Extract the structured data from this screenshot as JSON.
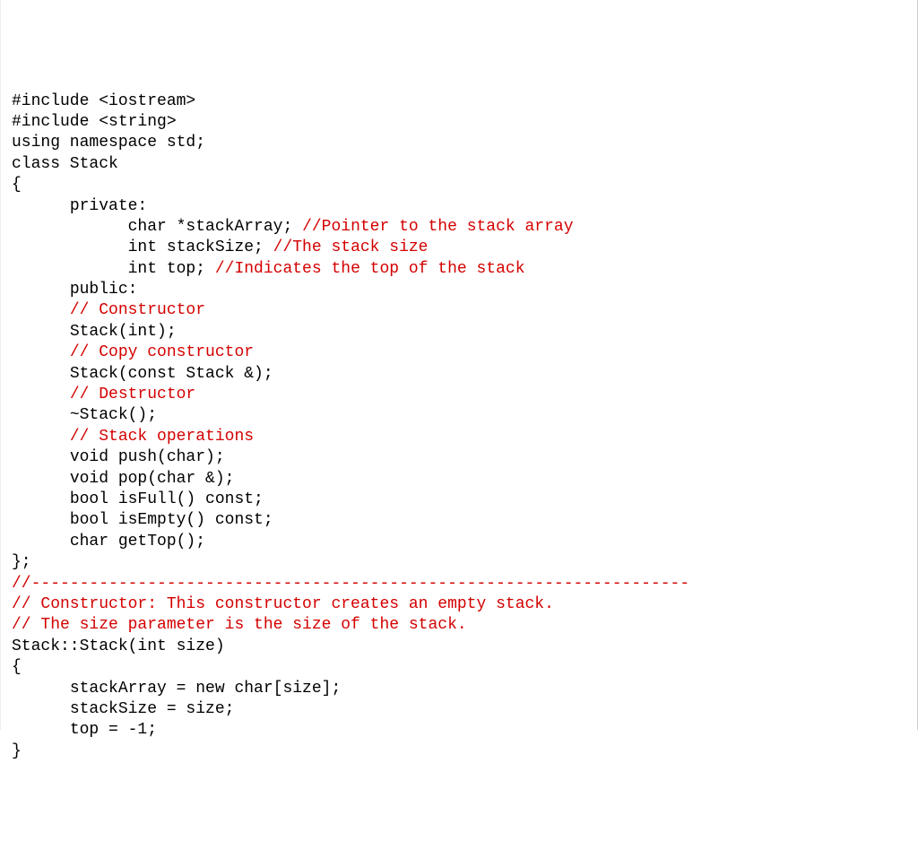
{
  "lines": [
    {
      "indent": 0,
      "parts": [
        {
          "t": "#include <iostream>",
          "c": "k"
        }
      ]
    },
    {
      "indent": 0,
      "parts": [
        {
          "t": "#include <string>",
          "c": "k"
        }
      ]
    },
    {
      "indent": 0,
      "parts": [
        {
          "t": "using namespace std;",
          "c": "k"
        }
      ]
    },
    {
      "indent": 0,
      "parts": [
        {
          "t": "",
          "c": "k"
        }
      ]
    },
    {
      "indent": 0,
      "parts": [
        {
          "t": "class Stack",
          "c": "k"
        }
      ]
    },
    {
      "indent": 0,
      "parts": [
        {
          "t": "{",
          "c": "k"
        }
      ]
    },
    {
      "indent": 1,
      "parts": [
        {
          "t": "private:",
          "c": "k"
        }
      ]
    },
    {
      "indent": 2,
      "parts": [
        {
          "t": "char *stackArray; ",
          "c": "k"
        },
        {
          "t": "//Pointer to the stack array",
          "c": "c"
        }
      ]
    },
    {
      "indent": 2,
      "parts": [
        {
          "t": "int stackSize; ",
          "c": "k"
        },
        {
          "t": "//The stack size",
          "c": "c"
        }
      ]
    },
    {
      "indent": 2,
      "parts": [
        {
          "t": "int top; ",
          "c": "k"
        },
        {
          "t": "//Indicates the top of the stack",
          "c": "c"
        }
      ]
    },
    {
      "indent": 1,
      "parts": [
        {
          "t": "public:",
          "c": "k"
        }
      ]
    },
    {
      "indent": 1,
      "parts": [
        {
          "t": "// Constructor",
          "c": "c"
        }
      ]
    },
    {
      "indent": 1,
      "parts": [
        {
          "t": "Stack(int);",
          "c": "k"
        }
      ]
    },
    {
      "indent": 1,
      "parts": [
        {
          "t": "// Copy constructor",
          "c": "c"
        }
      ]
    },
    {
      "indent": 1,
      "parts": [
        {
          "t": "Stack(const Stack &);",
          "c": "k"
        }
      ]
    },
    {
      "indent": 1,
      "parts": [
        {
          "t": "// Destructor",
          "c": "c"
        }
      ]
    },
    {
      "indent": 1,
      "parts": [
        {
          "t": "~Stack();",
          "c": "k"
        }
      ]
    },
    {
      "indent": 1,
      "parts": [
        {
          "t": "// Stack operations",
          "c": "c"
        }
      ]
    },
    {
      "indent": 1,
      "parts": [
        {
          "t": "void push(char);",
          "c": "k"
        }
      ]
    },
    {
      "indent": 1,
      "parts": [
        {
          "t": "void pop(char &);",
          "c": "k"
        }
      ]
    },
    {
      "indent": 1,
      "parts": [
        {
          "t": "bool isFull() const;",
          "c": "k"
        }
      ]
    },
    {
      "indent": 1,
      "parts": [
        {
          "t": "bool isEmpty() const;",
          "c": "k"
        }
      ]
    },
    {
      "indent": 1,
      "parts": [
        {
          "t": "char getTop();",
          "c": "k"
        }
      ]
    },
    {
      "indent": 0,
      "parts": [
        {
          "t": "};",
          "c": "k"
        }
      ]
    },
    {
      "indent": 0,
      "parts": [
        {
          "t": "",
          "c": "k"
        }
      ]
    },
    {
      "indent": 0,
      "parts": [
        {
          "t": "//--------------------------------------------------------------------",
          "c": "c"
        }
      ]
    },
    {
      "indent": 0,
      "parts": [
        {
          "t": "// Constructor: This constructor creates an empty stack.",
          "c": "c"
        }
      ]
    },
    {
      "indent": 0,
      "parts": [
        {
          "t": "// The size parameter is the size of the stack.",
          "c": "c"
        }
      ]
    },
    {
      "indent": 0,
      "parts": [
        {
          "t": "Stack::Stack(int size)",
          "c": "k"
        }
      ]
    },
    {
      "indent": 0,
      "parts": [
        {
          "t": "{",
          "c": "k"
        }
      ]
    },
    {
      "indent": 1,
      "parts": [
        {
          "t": "stackArray = new char[size];",
          "c": "k"
        }
      ]
    },
    {
      "indent": 1,
      "parts": [
        {
          "t": "stackSize = size;",
          "c": "k"
        }
      ]
    },
    {
      "indent": 1,
      "parts": [
        {
          "t": "top = -1;",
          "c": "k"
        }
      ]
    },
    {
      "indent": 0,
      "parts": [
        {
          "t": "}",
          "c": "k"
        }
      ]
    }
  ],
  "indentUnit": "      "
}
